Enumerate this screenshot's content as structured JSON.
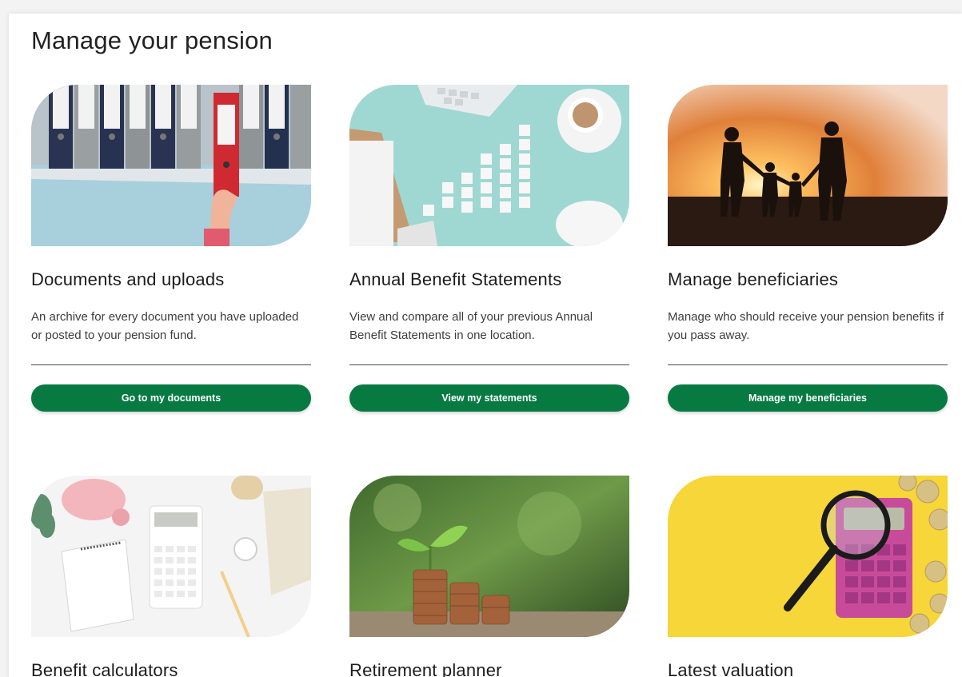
{
  "page": {
    "title": "Manage your pension"
  },
  "cards": [
    {
      "title": "Documents and uploads",
      "description": "An archive for every document you have uploaded or posted to your pension fund.",
      "button": "Go to my documents",
      "image": "red-binder-on-shelf-image"
    },
    {
      "title": "Annual Benefit Statements",
      "description": "View and compare all of your previous Annual Benefit Statements in one location.",
      "button": "View my statements",
      "image": "keyboard-coffee-blocks-image"
    },
    {
      "title": "Manage beneficiaries",
      "description": "Manage who should receive your pension benefits if you pass away.",
      "button": "Manage my beneficiaries",
      "image": "family-sunset-silhouette-image"
    },
    {
      "title": "Benefit calculators",
      "image": "piggy-bank-calculator-desk-image"
    },
    {
      "title": "Retirement planner",
      "image": "coins-with-sprout-image"
    },
    {
      "title": "Latest valuation",
      "image": "magnifier-calculator-coins-image"
    }
  ],
  "colors": {
    "button": "#077a42",
    "panel": "#ffffff",
    "background": "#f3f3f3"
  }
}
